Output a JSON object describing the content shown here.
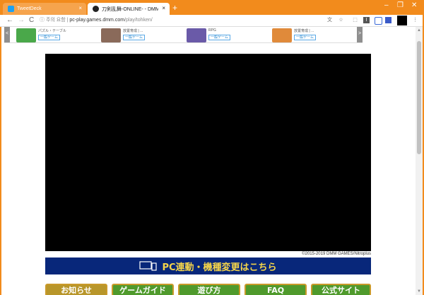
{
  "tabs": [
    {
      "title": "TweetDeck",
      "close": "×"
    },
    {
      "title": "刀剣乱舞-ONLINE- - DMM GAMES",
      "close": "×"
    }
  ],
  "newtab": "+",
  "window_controls": [
    "–",
    "❐",
    "✕"
  ],
  "toolbar": {
    "back": "←",
    "forward": "→",
    "reload": "C",
    "security": "주의 요함",
    "url_host": "pc-play.games.dmm.com",
    "url_path": "/play/tohken/"
  },
  "banner": {
    "prev": "<",
    "next": ">",
    "items": [
      {
        "category": "パズル・テーブル",
        "tag": "一般ゲーム",
        "color": "#4aa84a"
      },
      {
        "category": "放置育成 | ...",
        "tag": "一般ゲーム",
        "color": "#8a6a5a"
      },
      {
        "category": "RPG",
        "tag": "一般ゲーム",
        "color": "#6a5aa8"
      },
      {
        "category": "放置育成 | ...",
        "tag": "一般ゲーム",
        "color": "#e08a3a"
      }
    ]
  },
  "copyright": "©2015-2019 DMM GAMES/Nitroplus",
  "pc_banner": "PC連動・機種変更はこちら",
  "bottom_buttons": [
    {
      "label": "お知らせ",
      "color": "#b8962a"
    },
    {
      "label": "ゲームガイド",
      "color": "#4f9a2c"
    },
    {
      "label": "遊び方",
      "color": "#4f9a2c"
    },
    {
      "label": "FAQ",
      "color": "#4f9a2c"
    },
    {
      "label": "公式サイト",
      "color": "#4f9a2c"
    }
  ],
  "colors": {
    "frame": "#f28b1c",
    "game_bg": "#000000",
    "pc_banner_bg": "#08277a",
    "pc_banner_text": "#f5d54a"
  }
}
